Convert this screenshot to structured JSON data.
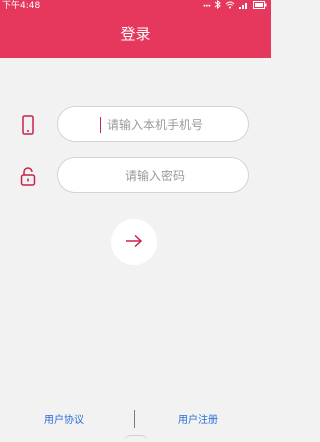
{
  "status_bar": {
    "time": "下午4:48",
    "icons": [
      "more-dots-icon",
      "bluetooth-icon",
      "wifi-icon",
      "signal-icon",
      "battery-icon"
    ]
  },
  "header": {
    "title": "登录",
    "background": "#e5385c"
  },
  "form": {
    "phone_placeholder": "请输入本机手机号",
    "phone_icon": "mobile-phone-icon",
    "password_placeholder": "请输入密码",
    "password_icon": "unlock-icon",
    "submit_icon": "arrow-right-icon"
  },
  "footer": {
    "agreement_label": "用户协议",
    "register_label": "用户注册"
  },
  "colors": {
    "accent": "#e5385c",
    "link": "#2a6ddb",
    "background": "#f2f2f2"
  }
}
